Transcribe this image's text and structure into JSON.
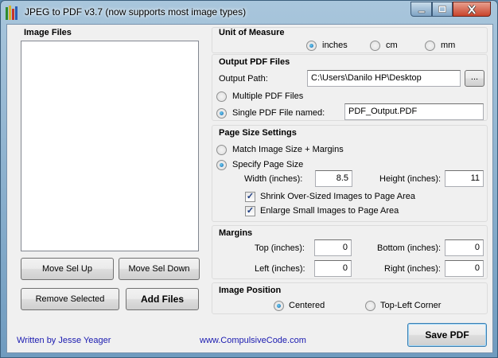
{
  "window": {
    "title": "JPEG to PDF  v3.7    (now supports most image types)"
  },
  "image_files": {
    "title": "Image Files",
    "move_up_label": "Move Sel Up",
    "move_down_label": "Move Sel Down",
    "remove_label": "Remove Selected",
    "add_label": "Add Files"
  },
  "unit": {
    "title": "Unit of Measure",
    "options": [
      "inches",
      "cm",
      "mm"
    ],
    "selected": "inches"
  },
  "output": {
    "title": "Output PDF Files",
    "path_label": "Output Path:",
    "path_value": "C:\\Users\\Danilo HP\\Desktop",
    "browse_label": "...",
    "multiple_label": "Multiple PDF Files",
    "single_label": "Single PDF File named:",
    "single_value": "PDF_Output.PDF"
  },
  "page_size": {
    "title": "Page Size Settings",
    "match_label": "Match Image Size + Margins",
    "specify_label": "Specify Page Size",
    "width_label": "Width (inches):",
    "width_value": "8.5",
    "height_label": "Height (inches):",
    "height_value": "11",
    "shrink_label": "Shrink Over-Sized Images to Page Area",
    "enlarge_label": "Enlarge Small Images to Page Area"
  },
  "margins": {
    "title": "Margins",
    "top_label": "Top (inches):",
    "top_value": "0",
    "bottom_label": "Bottom (inches):",
    "bottom_value": "0",
    "left_label": "Left (inches):",
    "left_value": "0",
    "right_label": "Right (inches):",
    "right_value": "0"
  },
  "position": {
    "title": "Image Position",
    "centered_label": "Centered",
    "topleft_label": "Top-Left Corner"
  },
  "footer": {
    "author": "Written by Jesse Yeager",
    "website": "www.CompulsiveCode.com",
    "save_label": "Save PDF"
  },
  "icons": {
    "minimize": "minimize-icon",
    "maximize": "maximize-icon",
    "close": "close-icon",
    "app": "app-icon"
  }
}
